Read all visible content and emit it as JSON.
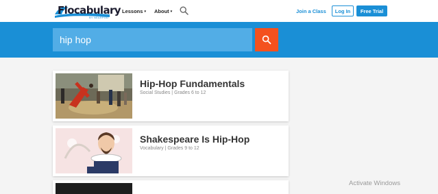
{
  "header": {
    "logo": {
      "word": "Flocabulary",
      "sub": "BY NEARPOD"
    },
    "nav": [
      {
        "label": "Lessons",
        "caret": "▾"
      },
      {
        "label": "About",
        "caret": "▾"
      }
    ],
    "search_icon": "search-icon",
    "join_label": "Join a Class",
    "login_label": "Log In",
    "trial_label": "Free Trial"
  },
  "search": {
    "value": "hip hop",
    "button_icon": "search-icon"
  },
  "results": [
    {
      "title": "Hip-Hop Fundamentals",
      "meta": "Social Studies | Grades 6 to 12"
    },
    {
      "title": "Shakespeare Is Hip-Hop",
      "meta": "Vocabulary | Grades 9 to 12"
    }
  ],
  "watermark": "Activate Windows",
  "colors": {
    "brand_blue": "#1a8fd6",
    "search_field": "#52ade6",
    "accent_orange": "#f4511e"
  }
}
